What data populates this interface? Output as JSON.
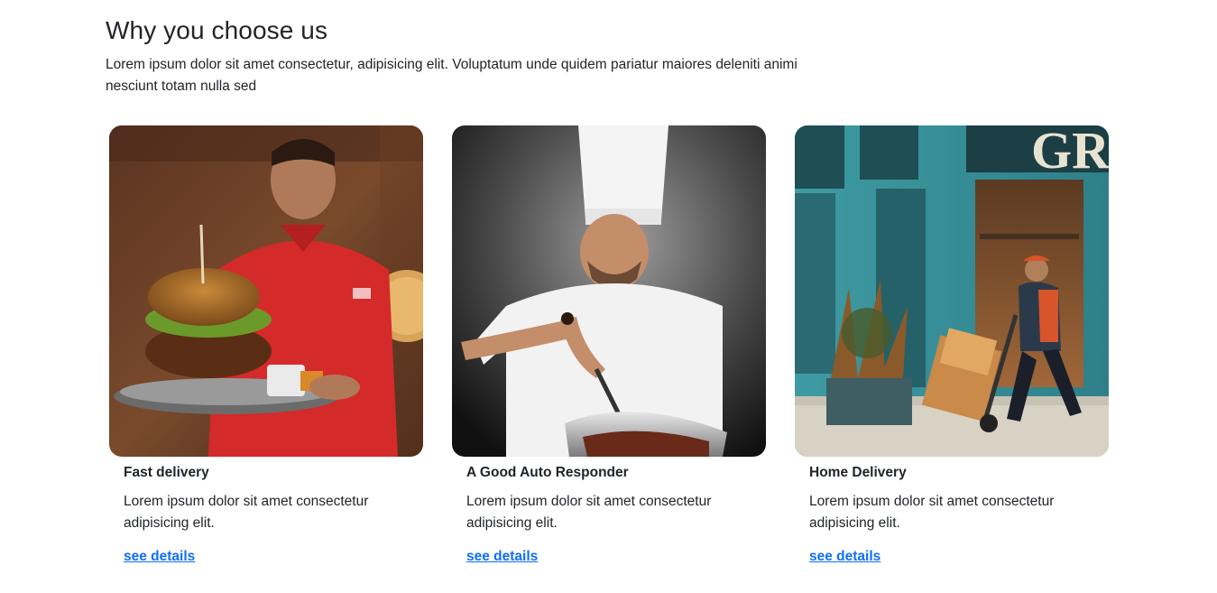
{
  "section": {
    "title": "Why you choose us",
    "intro": "Lorem ipsum dolor sit amet consectetur, adipisicing elit. Voluptatum unde quidem pariatur maiores deleniti animi nesciunt totam nulla sed"
  },
  "cards": [
    {
      "title": "Fast delivery",
      "text": "Lorem ipsum dolor sit amet consectetur adipisicing elit.",
      "link": "see details",
      "image": "man-holding-burger-plate-photo"
    },
    {
      "title": "A Good Auto Responder",
      "text": "Lorem ipsum dolor sit amet consectetur adipisicing elit.",
      "link": "see details",
      "image": "chef-cooking-photo"
    },
    {
      "title": "Home Delivery",
      "text": "Lorem ipsum dolor sit amet consectetur adipisicing elit.",
      "link": "see details",
      "image": "courier-with-hand-truck-photo"
    }
  ],
  "colors": {
    "text": "#212529",
    "link": "#0d6efd"
  }
}
